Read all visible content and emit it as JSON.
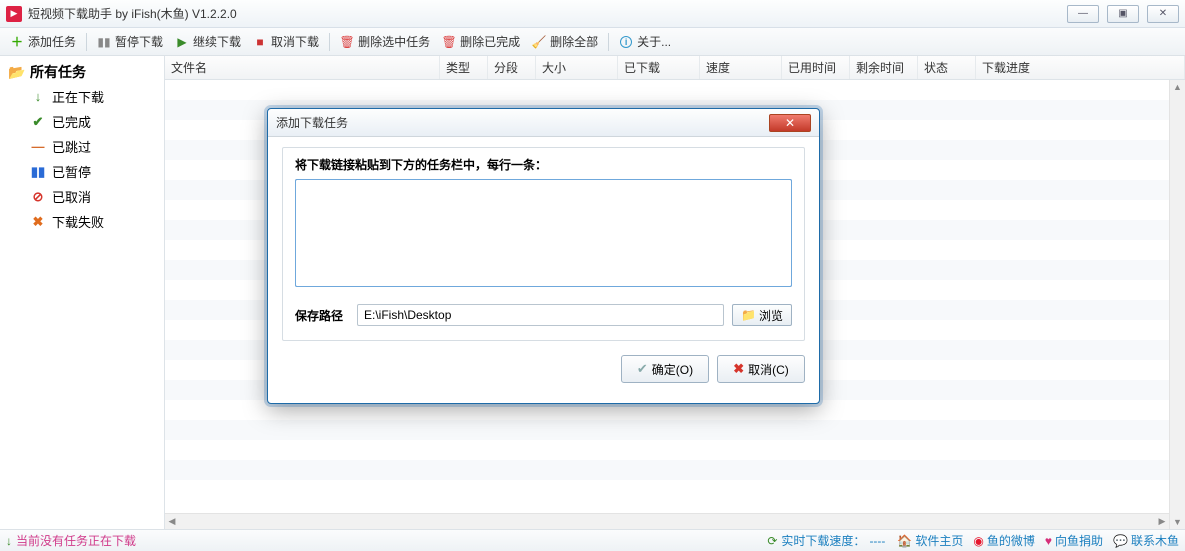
{
  "window": {
    "title": "短视频下载助手 by iFish(木鱼) V1.2.2.0"
  },
  "toolbar": {
    "add": "添加任务",
    "pause": "暂停下载",
    "resume": "继续下载",
    "cancel": "取消下载",
    "delete_selected": "删除选中任务",
    "delete_done": "删除已完成",
    "delete_all": "删除全部",
    "about": "关于..."
  },
  "sidebar": {
    "root": "所有任务",
    "items": [
      {
        "label": "正在下载"
      },
      {
        "label": "已完成"
      },
      {
        "label": "已跳过"
      },
      {
        "label": "已暂停"
      },
      {
        "label": "已取消"
      },
      {
        "label": "下载失败"
      }
    ]
  },
  "columns": [
    "文件名",
    "类型",
    "分段",
    "大小",
    "已下载",
    "速度",
    "已用时间",
    "剩余时间",
    "状态",
    "下载进度"
  ],
  "statusbar": {
    "left": "当前没有任务正在下载",
    "speed_label": "实时下载速度：",
    "speed_value": "----",
    "links": [
      "软件主页",
      "鱼的微博",
      "向鱼捐助",
      "联系木鱼"
    ]
  },
  "dialog": {
    "title": "添加下载任务",
    "hint": "将下载链接粘贴到下方的任务栏中，每行一条：",
    "path_label": "保存路径",
    "path_value": "E:\\iFish\\Desktop",
    "browse": "浏览",
    "ok": "确定(O)",
    "cancel": "取消(C)"
  }
}
